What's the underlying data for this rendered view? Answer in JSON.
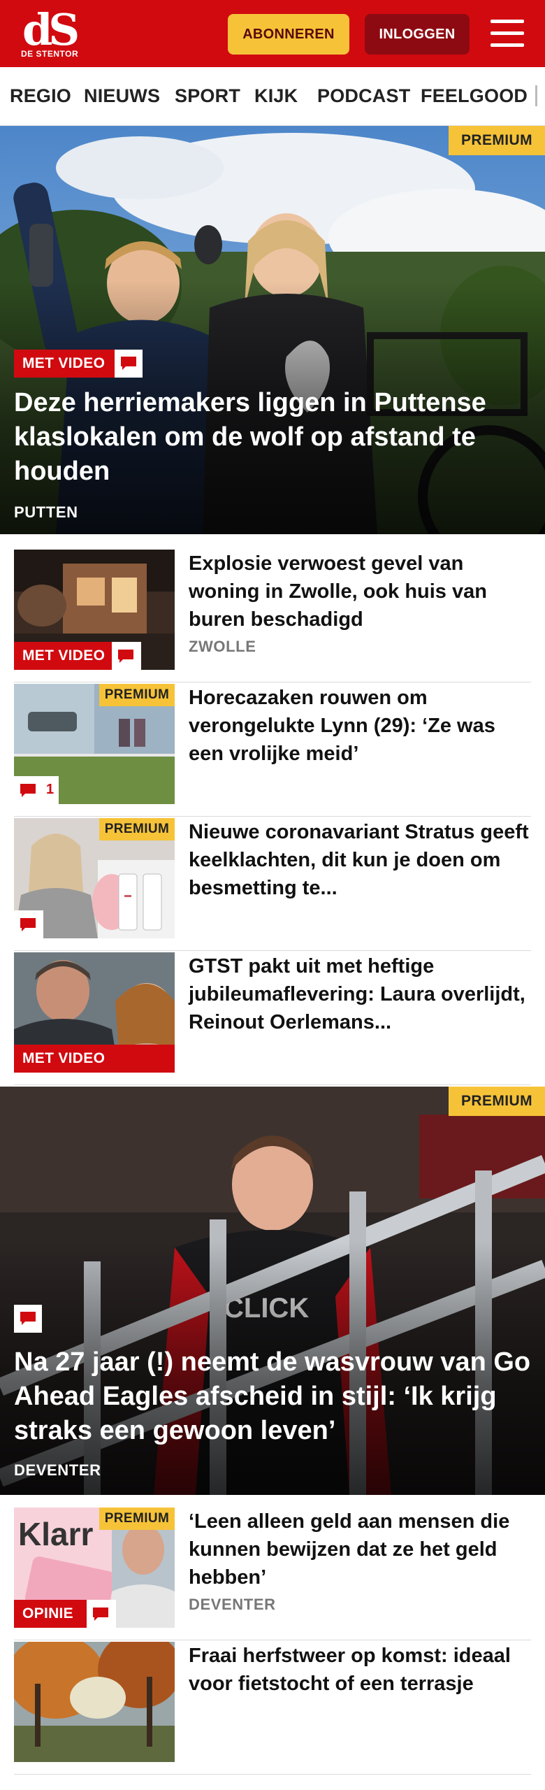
{
  "header": {
    "logo_mark": "dS",
    "logo_name": "DE STENTOR",
    "subscribe_label": "ABONNEREN",
    "login_label": "INLOGGEN"
  },
  "nav": {
    "items": [
      "REGIO",
      "NIEUWS",
      "SPORT",
      "KIJK",
      "PODCAST",
      "FEELGOOD"
    ]
  },
  "hero1": {
    "premium": "PREMIUM",
    "video_label": "MET VIDEO",
    "title": "Deze herriemakers liggen in Puttense klaslokalen om de wolf op afstand te houden",
    "location": "PUTTEN"
  },
  "articles": [
    {
      "title": "Explosie verwoest gevel van woning in Zwolle, ook huis van buren beschadigd",
      "location": "ZWOLLE",
      "badge": "MET VIDEO",
      "premium": ""
    },
    {
      "title": "Horecazaken rouwen om verongelukte Lynn (29): ‘Ze was een vrolijke meid’",
      "location": "",
      "badge": "",
      "premium": "PREMIUM",
      "comment_count": "1"
    },
    {
      "title": "Nieuwe coronavariant Stratus geeft keelklachten, dit kun je doen om besmetting te...",
      "location": "",
      "badge": "",
      "premium": "PREMIUM"
    },
    {
      "title": "GTST pakt uit met heftige jubileumaflevering: Laura overlijdt, Reinout Oerlemans...",
      "location": "",
      "badge": "MET VIDEO",
      "premium": ""
    }
  ],
  "hero2": {
    "premium": "PREMIUM",
    "title": "Na 27 jaar (!) neemt de wasvrouw van Go Ahead Eagles afscheid in stijl: ‘Ik krijg straks een gewoon leven’",
    "location": "DEVENTER"
  },
  "articles2": [
    {
      "title": "‘Leen alleen geld aan mensen die kunnen bewijzen dat ze het geld hebben’",
      "location": "DEVENTER",
      "badge": "OPINIE",
      "premium": "PREMIUM",
      "thumb_text": "Klarr"
    },
    {
      "title": "Fraai herfstweer op komst: ideaal voor fietstocht of een terrasje",
      "location": "",
      "badge": "",
      "premium": ""
    }
  ],
  "colors": {
    "brand_red": "#d10a10",
    "premium_yellow": "#f6c338",
    "login_dark_red": "#8e0a12"
  }
}
